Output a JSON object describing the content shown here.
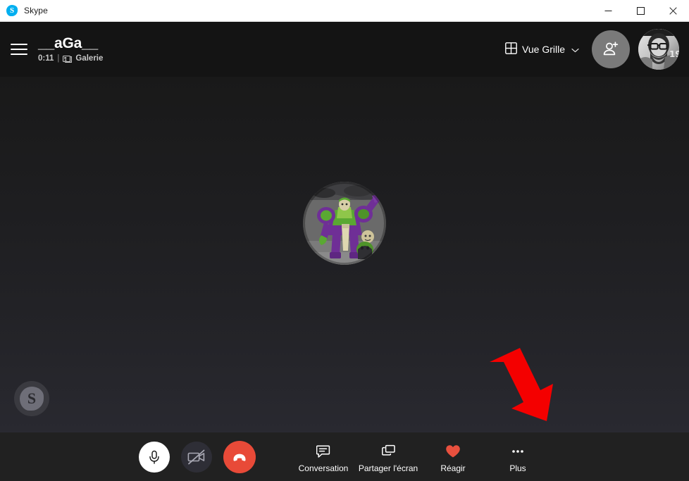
{
  "window": {
    "app_title": "Skype",
    "app_icon": "skype-logo-icon",
    "controls": {
      "minimize": "minimize-icon",
      "maximize": "maximize-icon",
      "close": "close-icon"
    }
  },
  "header": {
    "menu_icon": "hamburger-menu-icon",
    "call_title": "__aGa__",
    "call_duration": "0:11",
    "separator": "|",
    "layout_mode": "Galerie",
    "layout_mode_icon": "gallery-layout-icon",
    "view_toggle": {
      "label": "Vue Grille",
      "icon": "grid-view-icon",
      "chevron": "chevron-down-icon"
    },
    "add_people": {
      "name": "add-person-button",
      "icon": "person-add-icon"
    },
    "profile": {
      "name": "my-profile-avatar",
      "alt": "Photo de profil"
    }
  },
  "stage": {
    "participant": {
      "name": "participant-avatar",
      "alt": "Avatar du participant"
    },
    "self_preview": {
      "name": "self-video-thumbnail",
      "initial": "S"
    },
    "annotation": {
      "name": "red-arrow-annotation",
      "color": "#f40000",
      "direction": "down-right"
    }
  },
  "toolbar": {
    "controls": [
      {
        "name": "microphone-button",
        "icon": "microphone-icon",
        "state": "on"
      },
      {
        "name": "camera-button",
        "icon": "camera-off-icon",
        "state": "off"
      },
      {
        "name": "end-call-button",
        "icon": "end-call-icon",
        "state": "active"
      }
    ],
    "actions": [
      {
        "name": "chat-button",
        "label": "Conversation",
        "icon": "chat-bubble-icon"
      },
      {
        "name": "share-screen-button",
        "label": "Partager l'écran",
        "icon": "screen-share-icon"
      },
      {
        "name": "react-button",
        "label": "Réagir",
        "icon": "heart-icon"
      },
      {
        "name": "more-button",
        "label": "Plus",
        "icon": "ellipsis-icon"
      }
    ]
  },
  "colors": {
    "titlebar_bg": "#ffffff",
    "header_bg": "#141414",
    "stage_top": "#191919",
    "stage_bottom": "#292930",
    "toolbar_bg": "#212121",
    "end_call_red": "#e84a38",
    "heart_red": "#e8503e",
    "arrow_red": "#f40000",
    "skype_blue": "#00aff0"
  }
}
